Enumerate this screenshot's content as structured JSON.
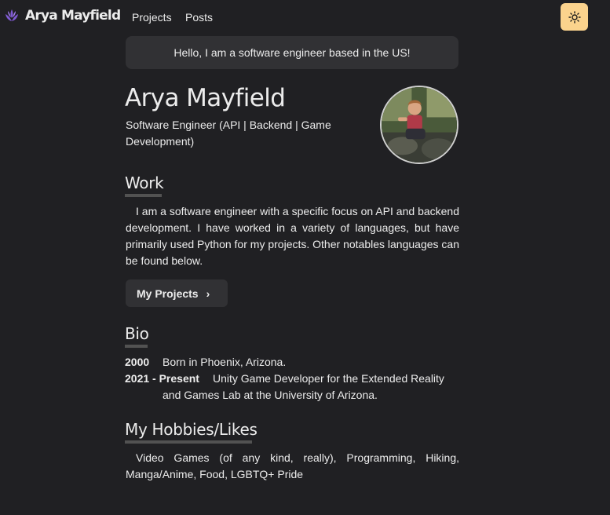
{
  "nav": {
    "brand": "Arya Mayfield",
    "links": [
      {
        "label": "Projects"
      },
      {
        "label": "Posts"
      }
    ],
    "theme_toggle_icon": "sun-icon",
    "theme_toggle_color": "#fbd38d"
  },
  "intro": {
    "text": "Hello, I am a software engineer based in the US!"
  },
  "profile": {
    "name": "Arya Mayfield",
    "role": "Software Engineer (API | Backend | Game Development)"
  },
  "work": {
    "title": "Work",
    "body": "I am a software engineer with a specific focus on API and backend development. I have worked in a variety of languages, but have primarily used Python for my projects. Other notables languages can be found below.",
    "button_label": "My Projects",
    "button_icon": "chevron-right-icon"
  },
  "bio": {
    "title": "Bio",
    "entries": [
      {
        "year": "2000",
        "text_lines": [
          "Born in Phoenix, Arizona."
        ]
      },
      {
        "year": "2021 - Present",
        "text_lines": [
          "Unity Game Developer for the Extended Reality",
          "and Games Lab at the University of Arizona."
        ]
      }
    ]
  },
  "hobbies": {
    "title": "My Hobbies/Likes",
    "body": "Video Games (of any kind, really), Programming, Hiking, Manga/Anime, Food, LGBTQ+ Pride"
  },
  "colors": {
    "background": "#202023",
    "card": "#313134",
    "accent": "#fbd38d",
    "logo": "#805ad5"
  }
}
